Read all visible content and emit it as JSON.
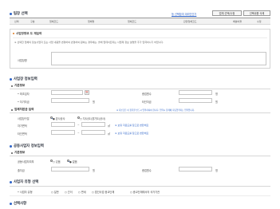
{
  "header": {
    "title": "팀장 선택",
    "link": "등 선택참여 대리인인가",
    "btn1": "업체 선택/수정",
    "btn2": "선택내용 삭제"
  },
  "table_head": [
    "선택",
    "구분",
    "업체코드",
    "업체명",
    "업체코드",
    "관장업체코드",
    "배분비율",
    "수정"
  ],
  "section1": {
    "title": "사업장정보 도 재입력",
    "note": "※ 선택한 업체의 정보사업자 또는 사업 내용을 변경하여 반영하여 원하는 경우에는, 솔해 업데이트되는 사업제 정보 설명을 추가 입력하시기 바랍니다.",
    "label": "사업장명"
  },
  "section2": {
    "title": "사업장 정보입력",
    "sub": "기본정보",
    "row1": {
      "label1": "• 최초입자",
      "cal": "📅",
      "label2": "종업원수",
      "unit2": "명"
    },
    "row2": {
      "label1": "• 자기자금",
      "unit1": "원",
      "label2": "타인자금",
      "unit2": "원"
    },
    "sub2": "업체자본금 입력",
    "sub2_note": "※ 자본금은 이 항목을 반드시 입력하셔야 합니다. 입력시 합계에 자동입력되는 입력입니다.",
    "row3": {
      "label": "사업장구분",
      "opt1": "● 본사공사",
      "opt2": "○ 지사(도)경기도(공사)"
    },
    "row4": {
      "label": "자기면적",
      "sep": "~",
      "unit": "㎡",
      "link": "※ 보유 자료도를 참고로 변환해요"
    },
    "row5": {
      "label": "타인면적",
      "sep": "~",
      "unit": "㎡",
      "link": "※ 보유 자료도를 참고로 변환해요"
    }
  },
  "section3": {
    "title": "공동사업자 정보입력",
    "sub": "기본정보",
    "row1": {
      "label": "공동사업자여부",
      "opt1": "○ 있음",
      "opt2": "● 없음"
    },
    "row2": {
      "label1": "출자금",
      "unit1": "원",
      "label2": "종업원수",
      "unit2": "명"
    }
  },
  "section4": {
    "title": "사업자 유형 선택",
    "label": "• 사업자 유형",
    "options": [
      "○ 일반",
      "○ 간이",
      "○ 면세",
      "○ 법인사업 종교단체",
      "○ 종교단체에서의 국가기관"
    ]
  },
  "section5": {
    "title": "선택사항"
  },
  "colors": {
    "accent": "#2d63c8",
    "border": "#c6c6c6"
  }
}
